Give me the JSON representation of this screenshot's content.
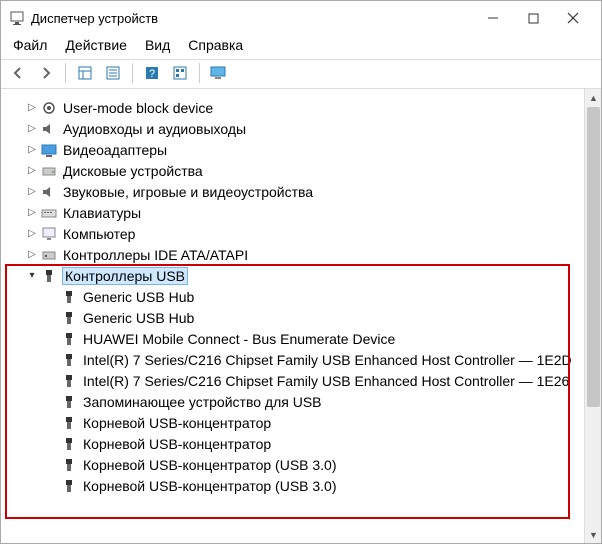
{
  "window": {
    "title": "Диспетчер устройств"
  },
  "menu": {
    "file": "Файл",
    "action": "Действие",
    "view": "Вид",
    "help": "Справка"
  },
  "tree": {
    "categories": [
      {
        "label": "User-mode block device"
      },
      {
        "label": "Аудиовходы и аудиовыходы"
      },
      {
        "label": "Видеоадаптеры"
      },
      {
        "label": "Дисковые устройства"
      },
      {
        "label": "Звуковые, игровые и видеоустройства"
      },
      {
        "label": "Клавиатуры"
      },
      {
        "label": "Компьютер"
      },
      {
        "label": "Контроллеры IDE ATA/ATAPI"
      },
      {
        "label": "Контроллеры USB"
      }
    ],
    "usb_children": [
      {
        "label": "Generic USB Hub"
      },
      {
        "label": "Generic USB Hub"
      },
      {
        "label": "HUAWEI Mobile Connect - Bus Enumerate Device"
      },
      {
        "label": "Intel(R) 7 Series/C216 Chipset Family USB Enhanced Host Controller — 1E2D"
      },
      {
        "label": "Intel(R) 7 Series/C216 Chipset Family USB Enhanced Host Controller — 1E26"
      },
      {
        "label": "Запоминающее устройство для USB"
      },
      {
        "label": "Корневой USB-концентратор"
      },
      {
        "label": "Корневой USB-концентратор"
      },
      {
        "label": "Корневой USB-концентратор (USB 3.0)"
      },
      {
        "label": "Корневой USB-концентратор (USB 3.0)"
      }
    ]
  }
}
